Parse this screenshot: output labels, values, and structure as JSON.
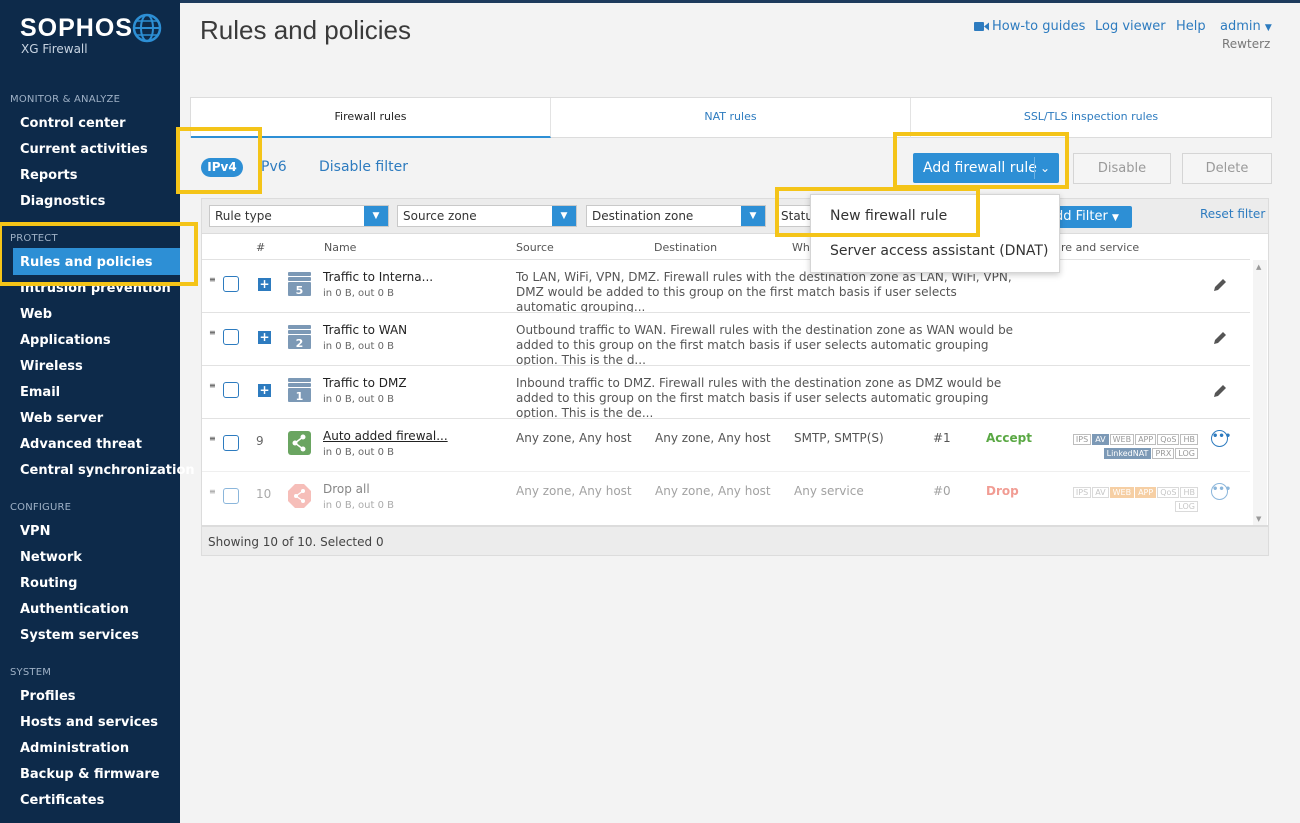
{
  "brand": {
    "name": "SOPHOS",
    "product": "XG Firewall"
  },
  "sidebar": {
    "sections": [
      {
        "title": "MONITOR & ANALYZE",
        "items": [
          "Control center",
          "Current activities",
          "Reports",
          "Diagnostics"
        ]
      },
      {
        "title": "PROTECT",
        "items": [
          "Rules and policies",
          "Intrusion prevention",
          "Web",
          "Applications",
          "Wireless",
          "Email",
          "Web server",
          "Advanced threat",
          "Central synchronization"
        ]
      },
      {
        "title": "CONFIGURE",
        "items": [
          "VPN",
          "Network",
          "Routing",
          "Authentication",
          "System services"
        ]
      },
      {
        "title": "SYSTEM",
        "items": [
          "Profiles",
          "Hosts and services",
          "Administration",
          "Backup & firmware",
          "Certificates"
        ]
      }
    ],
    "active": "Rules and policies"
  },
  "header": {
    "title": "Rules and policies",
    "links": {
      "howto": "How-to guides",
      "logviewer": "Log viewer",
      "help": "Help",
      "admin": "admin"
    },
    "username": "Rewterz"
  },
  "tabs": [
    "Firewall rules",
    "NAT rules",
    "SSL/TLS inspection rules"
  ],
  "toolbar": {
    "ipv4": "IPv4",
    "ipv6": "Pv6",
    "disable_filter": "Disable filter",
    "add_rule": "Add firewall rule",
    "disable": "Disable",
    "delete": "Delete"
  },
  "filters": {
    "rule_type": "Rule type",
    "source_zone": "Source zone",
    "destination_zone": "Destination zone",
    "status": "Statu",
    "add_filter": "dd Filter",
    "reset_filter": "Reset filter"
  },
  "columns": {
    "num": "#",
    "name": "Name",
    "source": "Source",
    "destination": "Destination",
    "what": "Wh",
    "feature": "ature and service"
  },
  "dropdown": {
    "new_rule": "New firewall rule",
    "dnat": "Server access assistant (DNAT)"
  },
  "rows": [
    {
      "name": "Traffic to Interna...",
      "sub": "in 0 B, out 0 B",
      "group_num": "5",
      "desc": "To LAN, WiFi, VPN, DMZ. Firewall rules with the destination zone as LAN, WiFi, VPN, DMZ would be added to this group on the first match basis if user selects automatic grouping..."
    },
    {
      "name": "Traffic to WAN",
      "sub": "in 0 B, out 0 B",
      "group_num": "2",
      "desc": "Outbound traffic to WAN. Firewall rules with the destination zone as WAN would be added to this group on the first match basis if user selects automatic grouping option. This is the d..."
    },
    {
      "name": "Traffic to DMZ",
      "sub": "in 0 B, out 0 B",
      "group_num": "1",
      "desc": "Inbound traffic to DMZ. Firewall rules with the destination zone as DMZ would be added to this group on the first match basis if user selects automatic grouping option. This is the de..."
    },
    {
      "num": "9",
      "name": "Auto added firewal...",
      "sub": "in 0 B, out 0 B",
      "source": "Any zone, Any host",
      "destination": "Any zone, Any host",
      "service": "SMTP, SMTP(S)",
      "id": "#1",
      "action": "Accept"
    },
    {
      "num": "10",
      "name": "Drop all",
      "sub": "in 0 B, out 0 B",
      "source": "Any zone, Any host",
      "destination": "Any zone, Any host",
      "service": "Any service",
      "id": "#0",
      "action": "Drop"
    }
  ],
  "badges": {
    "row1_line1": [
      "IPS",
      "AV",
      "WEB",
      "APP",
      "QoS",
      "HB"
    ],
    "row1_line2": [
      "LinkedNAT",
      "PRX",
      "LOG"
    ],
    "row2_line1": [
      "IPS",
      "AV",
      "WEB",
      "APP",
      "QoS",
      "HB"
    ],
    "row2_line2": [
      "LOG"
    ]
  },
  "footer": "Showing 10 of 10. Selected 0",
  "colors": {
    "sidebar": "#0d2a4a",
    "accent": "#2d8fd5",
    "highlight": "#f4c418",
    "accept": "#5aa844",
    "drop": "#e74c3c"
  }
}
